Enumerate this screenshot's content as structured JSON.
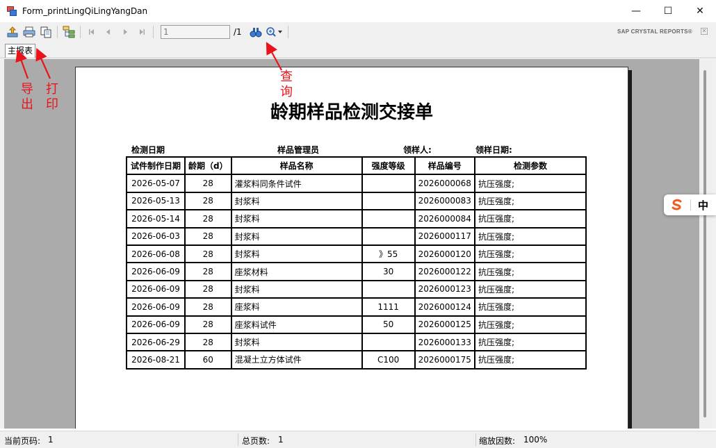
{
  "window": {
    "title": "Form_printLingQiLingYangDan",
    "minimize_glyph": "—",
    "maximize_glyph": "☐",
    "close_glyph": "✕"
  },
  "toolbar": {
    "icons": [
      "export-icon",
      "print-icon",
      "copy-icon",
      "group-tree-icon",
      "first-page-icon",
      "prev-page-icon",
      "next-page-icon",
      "last-page-icon",
      "binoculars-icon",
      "zoom-icon"
    ],
    "page_input_value": "1",
    "page_total": "/1",
    "brand": "SAP CRYSTAL REPORTS®"
  },
  "tabs": [
    {
      "label": "主报表"
    }
  ],
  "report": {
    "title": "龄期样品检测交接单",
    "header_fields": {
      "test_date": "检测日期",
      "sample_manager": "样品管理员",
      "receiver": "领样人:",
      "receive_date": "领样日期:"
    },
    "columns": [
      "试件制作日期",
      "龄期（d）",
      "样品名称",
      "强度等级",
      "样品编号",
      "检测参数"
    ],
    "rows": [
      {
        "date": "2026-05-07",
        "age": "28",
        "name": "灌浆料同条件试件",
        "grade": "",
        "code": "2026000068",
        "param": "抗压强度;"
      },
      {
        "date": "2026-05-13",
        "age": "28",
        "name": "封浆料",
        "grade": "",
        "code": "2026000083",
        "param": "抗压强度;"
      },
      {
        "date": "2026-05-14",
        "age": "28",
        "name": "封浆料",
        "grade": "",
        "code": "2026000084",
        "param": "抗压强度;"
      },
      {
        "date": "2026-06-03",
        "age": "28",
        "name": "封浆料",
        "grade": "",
        "code": "2026000117",
        "param": "抗压强度;"
      },
      {
        "date": "2026-06-08",
        "age": "28",
        "name": "封浆料",
        "grade": "》55",
        "code": "2026000120",
        "param": "抗压强度;"
      },
      {
        "date": "2026-06-09",
        "age": "28",
        "name": "座浆材料",
        "grade": "30",
        "code": "2026000122",
        "param": "抗压强度;"
      },
      {
        "date": "2026-06-09",
        "age": "28",
        "name": "封浆料",
        "grade": "",
        "code": "2026000123",
        "param": "抗压强度;"
      },
      {
        "date": "2026-06-09",
        "age": "28",
        "name": "座浆料",
        "grade": "1111",
        "code": "2026000124",
        "param": "抗压强度;"
      },
      {
        "date": "2026-06-09",
        "age": "28",
        "name": "座浆料试件",
        "grade": "50",
        "code": "2026000125",
        "param": "抗压强度;"
      },
      {
        "date": "2026-06-29",
        "age": "28",
        "name": "封浆料",
        "grade": "",
        "code": "2026000133",
        "param": "抗压强度;"
      },
      {
        "date": "2026-08-21",
        "age": "60",
        "name": "混凝土立方体试件",
        "grade": "C100",
        "code": "2026000175",
        "param": "抗压强度;"
      }
    ]
  },
  "status_bar": {
    "current_page_label": "当前页码:",
    "current_page": "1",
    "total_pages_label": "总页数:",
    "total_pages": "1",
    "zoom_label": "缩放因数:",
    "zoom_value": "100%"
  },
  "annotations": {
    "export_a": "导",
    "export_b": "出",
    "print_a": "打",
    "print_b": "印",
    "search_a": "查",
    "search_b": "询",
    "color": "#e8141a"
  },
  "ime": {
    "mode": "中"
  }
}
